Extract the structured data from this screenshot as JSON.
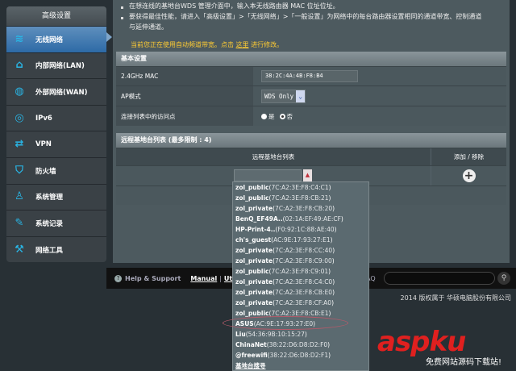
{
  "sidebar": {
    "title": "高级设置",
    "items": [
      {
        "label": "无线网络",
        "icon": "wifi-icon",
        "glyph": "≋"
      },
      {
        "label": "内部网络(LAN)",
        "icon": "home-icon",
        "glyph": "⌂"
      },
      {
        "label": "外部网络(WAN)",
        "icon": "globe-icon",
        "glyph": "◍"
      },
      {
        "label": "IPv6",
        "icon": "ipv6-globe-icon",
        "glyph": "◎"
      },
      {
        "label": "VPN",
        "icon": "vpn-icon",
        "glyph": "⇄"
      },
      {
        "label": "防火墙",
        "icon": "shield-icon",
        "glyph": "⛉"
      },
      {
        "label": "系统管理",
        "icon": "user-admin-icon",
        "glyph": "♙"
      },
      {
        "label": "系统记录",
        "icon": "log-edit-icon",
        "glyph": "✎"
      },
      {
        "label": "网络工具",
        "icon": "wrench-icon",
        "glyph": "⚒"
      }
    ]
  },
  "notes": [
    "在想连线的基地台WDS 管理介面中，输入本无线路由器 MAC 位址位址。",
    "要获得最佳性能，请进入「高级设置」>「无线网络」>「一般设置」为网络中的每台路由器设置相同的通道带宽、控制通道",
    "与延伸通道。"
  ],
  "warning": {
    "prefix": "当前您正在使用自动频道带宽。点击 ",
    "link": "这里",
    "suffix": " 进行修改。"
  },
  "basic": {
    "title": "基本设置",
    "mac_label": "2.4GHz MAC",
    "mac_value": "38:2C:4A:4B:F8:B4",
    "ap_label": "AP模式",
    "ap_value": "WDS Only",
    "list_label": "连接列表中的访问点",
    "yes": "是",
    "no": "否"
  },
  "remote": {
    "title": "远程基地台列表 (最多限制 : 4)",
    "col1": "远程基地台列表",
    "col2": "添加 / 移除",
    "input_value": ""
  },
  "dropdown": [
    {
      "name": "zol_public",
      "mac": "7C:A2:3E:F8:C4:C1"
    },
    {
      "name": "zol_public",
      "mac": "7C:A2:3E:F8:CB:21"
    },
    {
      "name": "zol_private",
      "mac": "7C:A2:3E:F8:CB:20"
    },
    {
      "name": "BenQ_EF49A..",
      "mac": "02:1A:EF:49:AE:CF"
    },
    {
      "name": "HP-Print-4..",
      "mac": "F0:92:1C:88:AE:40"
    },
    {
      "name": "ch's_guest",
      "mac": "AC:9E:17:93:27:E1"
    },
    {
      "name": "zol_private",
      "mac": "7C:A2:3E:F8:CC:40"
    },
    {
      "name": "zol_private",
      "mac": "7C:A2:3E:F8:C9:00"
    },
    {
      "name": "zol_public",
      "mac": "7C:A2:3E:F8:C9:01"
    },
    {
      "name": "zol_private",
      "mac": "7C:A2:3E:F8:C4:C0"
    },
    {
      "name": "zol_private",
      "mac": "7C:A2:3E:F8:CB:E0"
    },
    {
      "name": "zol_private",
      "mac": "7C:A2:3E:F8:CF:A0"
    },
    {
      "name": "zol_public",
      "mac": "7C:A2:3E:F8:CB:E1"
    },
    {
      "name": "ASUS",
      "mac": "AC:9E:17:93:27:E0"
    },
    {
      "name": "Liu",
      "mac": "54:36:9B:10:15:27"
    },
    {
      "name": "ChinaNet",
      "mac": "38:22:D6:D8:D2:F0"
    },
    {
      "name": "@freewifi",
      "mac": "38:22:D6:D8:D2:F1"
    }
  ],
  "dropdown_footer": "基地台搜寻",
  "footer": {
    "help": "Help & Support",
    "manual": "Manual",
    "sep": "|",
    "utility": "Utility",
    "faq": "AQ"
  },
  "copyright": "2014 版权属于 华硕电脑股份有限公司",
  "watermark": {
    "logo": "aspku",
    "sub": "免费网站源码下载站!"
  }
}
